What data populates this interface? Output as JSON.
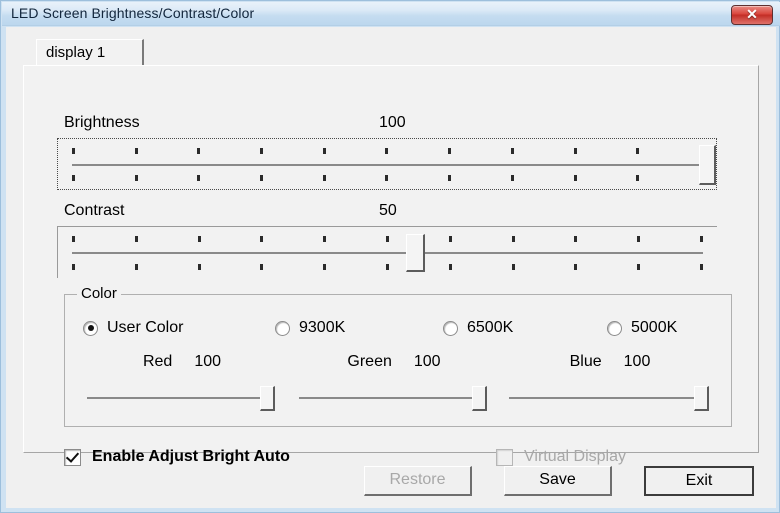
{
  "window": {
    "title": "LED Screen Brightness/Contrast/Color",
    "close_icon": "close-icon",
    "close_glyph": "✕"
  },
  "tabs": [
    {
      "label": "display 1",
      "selected": true
    }
  ],
  "brightness": {
    "label": "Brightness",
    "value": "100",
    "min": 0,
    "max": 100,
    "tick_count": 11,
    "thumb_position_percent": 100,
    "focused": true
  },
  "contrast": {
    "label": "Contrast",
    "value": "50",
    "min": 0,
    "max": 100,
    "tick_count": 11,
    "thumb_position_percent": 50,
    "focused": false
  },
  "color_group": {
    "title": "Color",
    "options": [
      {
        "label": "User Color",
        "selected": true
      },
      {
        "label": "9300K",
        "selected": false
      },
      {
        "label": "6500K",
        "selected": false
      },
      {
        "label": "5000K",
        "selected": false
      }
    ],
    "channels": [
      {
        "label": "Red",
        "value": "100",
        "thumb_position_percent": 100
      },
      {
        "label": "Green",
        "value": "100",
        "thumb_position_percent": 100
      },
      {
        "label": "Blue",
        "value": "100",
        "thumb_position_percent": 100
      }
    ]
  },
  "checkboxes": [
    {
      "label": "Enable Adjust Bright Auto",
      "checked": true,
      "disabled": false
    },
    {
      "label": "Virtual Display",
      "checked": false,
      "disabled": true
    }
  ],
  "buttons": [
    {
      "label": "Restore",
      "disabled": true,
      "default": false
    },
    {
      "label": "Save",
      "disabled": false,
      "default": false
    },
    {
      "label": "Exit",
      "disabled": false,
      "default": true
    }
  ],
  "colors": {
    "titlebar_top": "#e9f2fa",
    "titlebar_bottom": "#bcd7ee",
    "dialog_background": "#f0f0f0",
    "panel_background": "#f2f2f2",
    "close_button_red": "#d9453c",
    "disabled_text": "#a8a8a8",
    "text": "#000000"
  }
}
